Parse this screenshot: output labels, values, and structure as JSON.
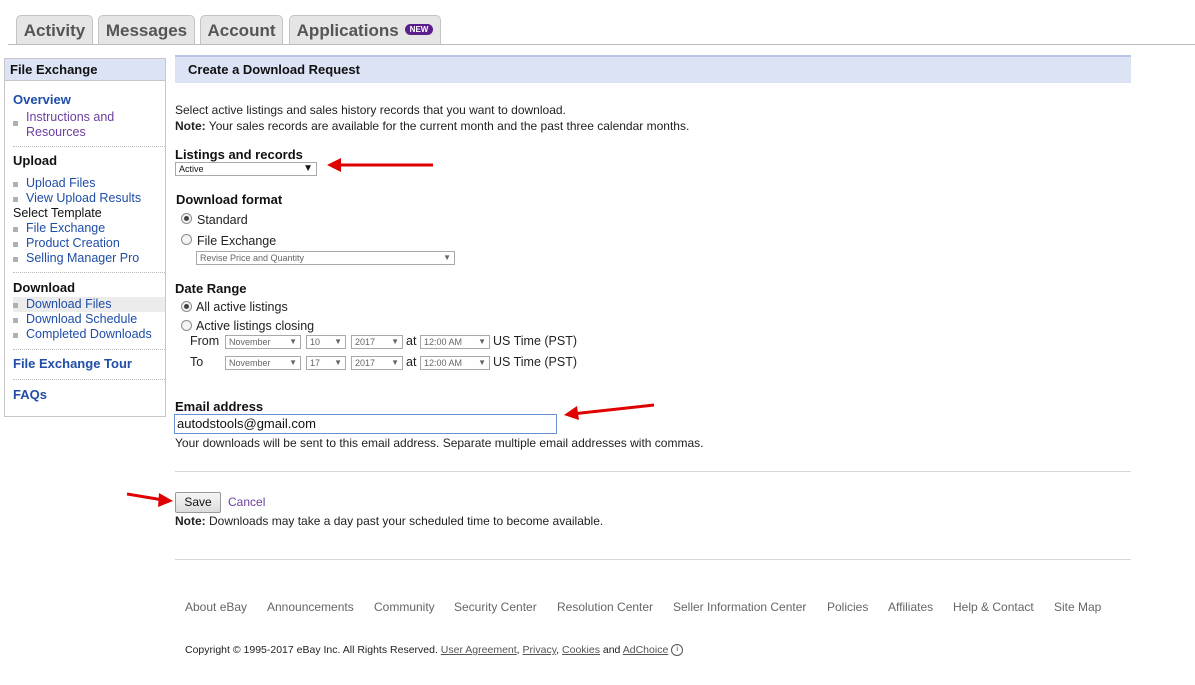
{
  "tabs": [
    {
      "label": "Activity"
    },
    {
      "label": "Messages"
    },
    {
      "label": "Account"
    },
    {
      "label": "Applications",
      "badge": "NEW"
    }
  ],
  "sidebar": {
    "title": "File Exchange",
    "overview": "Overview",
    "instructions_line1": "Instructions and",
    "instructions_line2": "Resources",
    "upload_heading": "Upload",
    "upload_files": "Upload Files",
    "view_upload_results": "View Upload Results",
    "select_template": "Select Template",
    "file_exchange": "File Exchange",
    "product_creation": "Product Creation",
    "selling_manager_pro": "Selling Manager Pro",
    "download_heading": "Download",
    "download_files": "Download Files",
    "download_schedule": "Download Schedule",
    "completed_downloads": "Completed Downloads",
    "tour": "File Exchange Tour",
    "faqs": "FAQs"
  },
  "main": {
    "header": "Create a Download Request",
    "intro": "Select active listings and sales history records that you want to download.",
    "note_label": "Note:",
    "note_text": " Your sales records are available for the current month and the past three calendar months.",
    "listings_label": "Listings and records",
    "listings_value": "Active",
    "format_label": "Download format",
    "format_standard": "Standard",
    "format_file_exchange": "File Exchange",
    "format_sub_value": "Revise Price and Quantity",
    "date_range_label": "Date Range",
    "all_active": "All active listings",
    "active_closing": "Active listings closing",
    "from_label": "From",
    "to_label": "To",
    "at_label": "at",
    "timezone": "US Time (PST)",
    "from": {
      "month": "November",
      "day": "10",
      "year": "2017",
      "time": "12:00 AM"
    },
    "to": {
      "month": "November",
      "day": "17",
      "year": "2017",
      "time": "12:00 AM"
    },
    "email_label": "Email address",
    "email_value": "autodstools@gmail.com",
    "email_help": "Your downloads will be sent to this email address. Separate multiple email addresses with commas.",
    "save_label": "Save",
    "cancel_label": "Cancel",
    "bottom_note_label": "Note:",
    "bottom_note_text": " Downloads may take a day past your scheduled time to become available."
  },
  "footer": {
    "links": [
      "About eBay",
      "Announcements",
      "Community",
      "Security Center",
      "Resolution Center",
      "Seller Information Center",
      "Policies",
      "Affiliates",
      "Help & Contact",
      "Site Map"
    ],
    "copyright": "Copyright © 1995-2017 eBay Inc. All Rights Reserved.",
    "user_agreement": "User Agreement",
    "privacy": "Privacy",
    "cookies": "Cookies",
    "and": "and",
    "adchoice": "AdChoice"
  },
  "colors": {
    "accent_header": "#dbe3f5",
    "link": "#1f4da8",
    "annotation_arrow": "#e00000"
  }
}
